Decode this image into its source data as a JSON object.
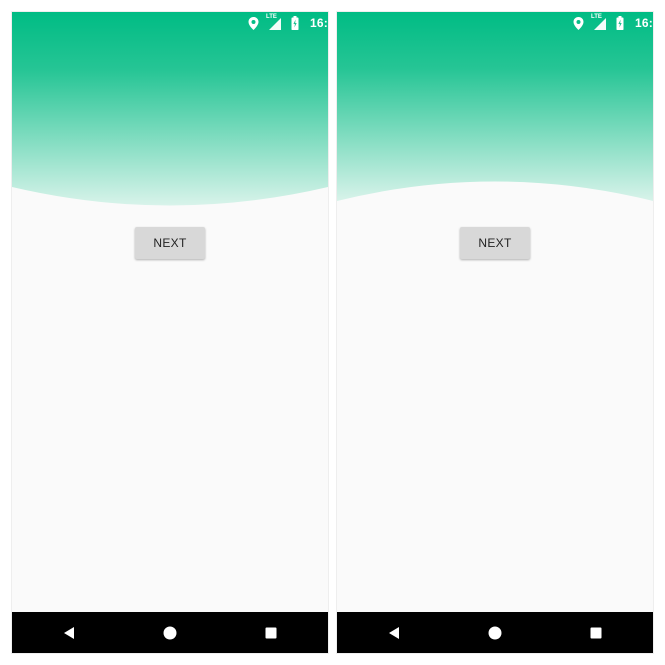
{
  "screens": [
    {
      "status_bar": {
        "network_label": "LTE",
        "clock": "16:"
      },
      "next_button_label": "NEXT",
      "header_curve": "convex-down"
    },
    {
      "status_bar": {
        "network_label": "LTE",
        "clock": "16:"
      },
      "next_button_label": "NEXT",
      "header_curve": "concave-up"
    }
  ],
  "colors": {
    "accent_green": "#00bc84",
    "background": "#fafafa",
    "nav_bar": "#000000",
    "button": "#d8d8d8"
  },
  "icons": {
    "status": [
      "location-icon",
      "signal-icon",
      "battery-charging-icon"
    ],
    "nav": [
      "back-icon",
      "home-icon",
      "recents-icon"
    ]
  }
}
